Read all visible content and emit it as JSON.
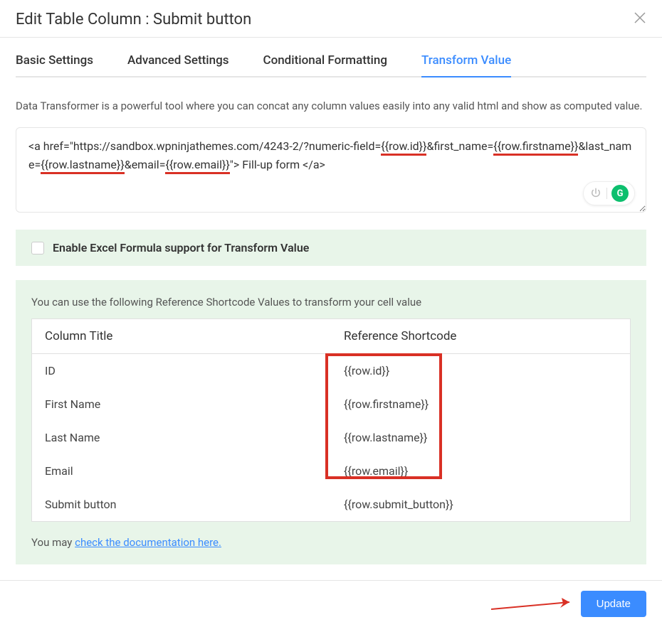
{
  "header": {
    "title": "Edit Table Column : Submit button"
  },
  "tabs": [
    {
      "label": "Basic Settings",
      "active": false
    },
    {
      "label": "Advanced Settings",
      "active": false
    },
    {
      "label": "Conditional Formatting",
      "active": false
    },
    {
      "label": "Transform Value",
      "active": true
    }
  ],
  "description": "Data Transformer is a powerful tool where you can concat any column values easily into any valid html and show as computed value.",
  "code": {
    "p1": "<a href=\"https://sandbox.wpninjathemes.com/4243-2/?numeric-field=",
    "s1": "{{row.id}}",
    "p2": "&first_name=",
    "s2": "{{row.firstname}}",
    "p3": "&last_name=",
    "s3": "{{row.lastname}}",
    "p4": "&email=",
    "s4": "{{row.email}}",
    "p5": "\"> Fill-up form </a>"
  },
  "checkbox": {
    "label": "Enable Excel Formula support for Transform Value"
  },
  "reference": {
    "intro": "You can use the following Reference Shortcode Values to transform your cell value",
    "columns": {
      "title": "Column Title",
      "shortcode": "Reference Shortcode"
    },
    "rows": [
      {
        "title": "ID",
        "shortcode": "{{row.id}}"
      },
      {
        "title": "First Name",
        "shortcode": "{{row.firstname}}"
      },
      {
        "title": "Last Name",
        "shortcode": "{{row.lastname}}"
      },
      {
        "title": "Email",
        "shortcode": "{{row.email}}"
      },
      {
        "title": "Submit button",
        "shortcode": "{{row.submit_button}}"
      }
    ],
    "doc_prefix": "You may ",
    "doc_link": "check the documentation here."
  },
  "footer": {
    "update_label": "Update"
  },
  "grammarly": {
    "g": "G"
  }
}
